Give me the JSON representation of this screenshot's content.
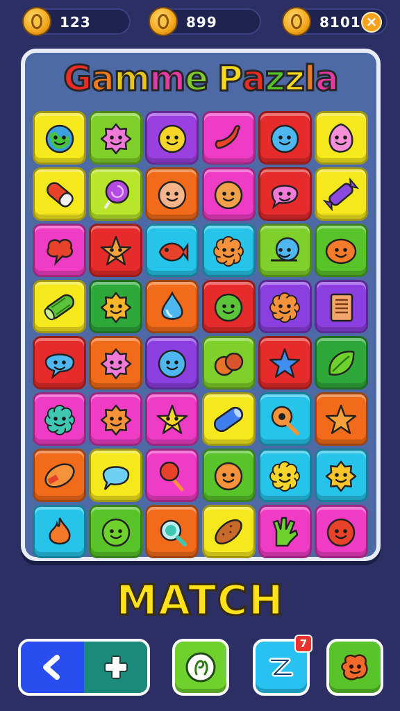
{
  "currency": [
    {
      "value": "123",
      "icon": "gold-coin-icon"
    },
    {
      "value": "899",
      "icon": "gold-coin-icon"
    },
    {
      "value": "8101",
      "icon": "gold-coin-icon"
    }
  ],
  "close_label": "×",
  "title": {
    "text": "Gamme Pazzla",
    "letter_colors": [
      "#ef2b22",
      "#f07b1a",
      "#e8c51c",
      "#e83aa3",
      "#7ccc2a",
      "#2db6e6",
      "#f7d81c",
      "#ef2b22",
      "#54c22a",
      "#f7d81c",
      "#f07b1a",
      "#e83aa3"
    ]
  },
  "board": {
    "rows": [
      [
        {
          "color": "#f5e81d",
          "icon": "green-globe-face-icon"
        },
        {
          "color": "#7fd02a",
          "icon": "pink-spiky-face-icon"
        },
        {
          "color": "#9a3fe0",
          "icon": "yellow-smiley-icon"
        },
        {
          "color": "#f03cc5",
          "icon": "red-chili-icon"
        },
        {
          "color": "#e52b2b",
          "icon": "blue-face-icon"
        },
        {
          "color": "#f5e81d",
          "icon": "pink-blob-face-icon"
        }
      ],
      [
        {
          "color": "#f5e81d",
          "icon": "red-pill-icon"
        },
        {
          "color": "#b9e52a",
          "icon": "purple-lollipop-icon"
        },
        {
          "color": "#f26b1a",
          "icon": "peach-face-icon"
        },
        {
          "color": "#f03cc5",
          "icon": "orange-smiley-icon"
        },
        {
          "color": "#e52b2b",
          "icon": "pink-speech-face-icon"
        },
        {
          "color": "#f5e81d",
          "icon": "purple-candy-icon"
        }
      ],
      [
        {
          "color": "#f03cc5",
          "icon": "red-splat-icon"
        },
        {
          "color": "#e52b2b",
          "icon": "orange-star-face-icon"
        },
        {
          "color": "#26c4ea",
          "icon": "red-fish-icon"
        },
        {
          "color": "#26c4ea",
          "icon": "orange-flower-face-icon"
        },
        {
          "color": "#7fd02a",
          "icon": "blue-snail-icon"
        },
        {
          "color": "#58c42a",
          "icon": "orange-oval-face-icon"
        }
      ],
      [
        {
          "color": "#f5e81d",
          "icon": "cucumber-icon"
        },
        {
          "color": "#2fa83a",
          "icon": "sun-gear-face-icon"
        },
        {
          "color": "#f26b1a",
          "icon": "blue-water-drop-icon"
        },
        {
          "color": "#e52b2b",
          "icon": "green-seed-face-icon"
        },
        {
          "color": "#8c3fe0",
          "icon": "orange-flower-face-icon"
        },
        {
          "color": "#8c3fe0",
          "icon": "notebook-icon"
        }
      ],
      [
        {
          "color": "#e52b2b",
          "icon": "blue-speech-face-icon"
        },
        {
          "color": "#f26b1a",
          "icon": "pink-spiky-face-icon"
        },
        {
          "color": "#8c3fe0",
          "icon": "blue-face-icon"
        },
        {
          "color": "#7fd02a",
          "icon": "orange-fruit-icon"
        },
        {
          "color": "#e52b2b",
          "icon": "blue-star-icon"
        },
        {
          "color": "#2fa83a",
          "icon": "green-leaf-icon"
        }
      ],
      [
        {
          "color": "#f03cc5",
          "icon": "teal-berry-face-icon"
        },
        {
          "color": "#f03cc5",
          "icon": "orange-sun-face-icon"
        },
        {
          "color": "#f03cc5",
          "icon": "yellow-star-face-icon"
        },
        {
          "color": "#f5e81d",
          "icon": "blue-capsule-icon"
        },
        {
          "color": "#26c4ea",
          "icon": "orange-key-icon"
        },
        {
          "color": "#f26b1a",
          "icon": "orange-star-icon"
        }
      ],
      [
        {
          "color": "#f26b1a",
          "icon": "orange-pod-icon"
        },
        {
          "color": "#f5e81d",
          "icon": "blue-speech-bubble-icon"
        },
        {
          "color": "#f03cc5",
          "icon": "red-lollipop-icon"
        },
        {
          "color": "#58c42a",
          "icon": "orange-round-face-icon"
        },
        {
          "color": "#26c4ea",
          "icon": "yellow-flower-face-icon"
        },
        {
          "color": "#26c4ea",
          "icon": "yellow-sun-face-icon"
        }
      ],
      [
        {
          "color": "#26c4ea",
          "icon": "orange-flame-icon"
        },
        {
          "color": "#58c42a",
          "icon": "green-bug-face-icon"
        },
        {
          "color": "#f26b1a",
          "icon": "teal-magnifier-icon"
        },
        {
          "color": "#f5e81d",
          "icon": "brown-sweet-potato-icon"
        },
        {
          "color": "#f03cc5",
          "icon": "green-hand-icon"
        },
        {
          "color": "#f03cc5",
          "icon": "red-round-face-icon"
        }
      ]
    ]
  },
  "match_label": "MATCH",
  "controls": {
    "back": {
      "icon": "chevron-left-icon",
      "color": "#2b4ef0"
    },
    "add": {
      "icon": "plus-icon",
      "color": "#1b8a7a"
    },
    "hint": {
      "icon": "swirl-hint-icon",
      "color": "#6fd12e"
    },
    "shuffle": {
      "icon": "shuffle-icon",
      "color": "#27c2f0",
      "badge": "7"
    },
    "special": {
      "icon": "orange-blob-face-icon",
      "color": "#58c42a"
    }
  }
}
